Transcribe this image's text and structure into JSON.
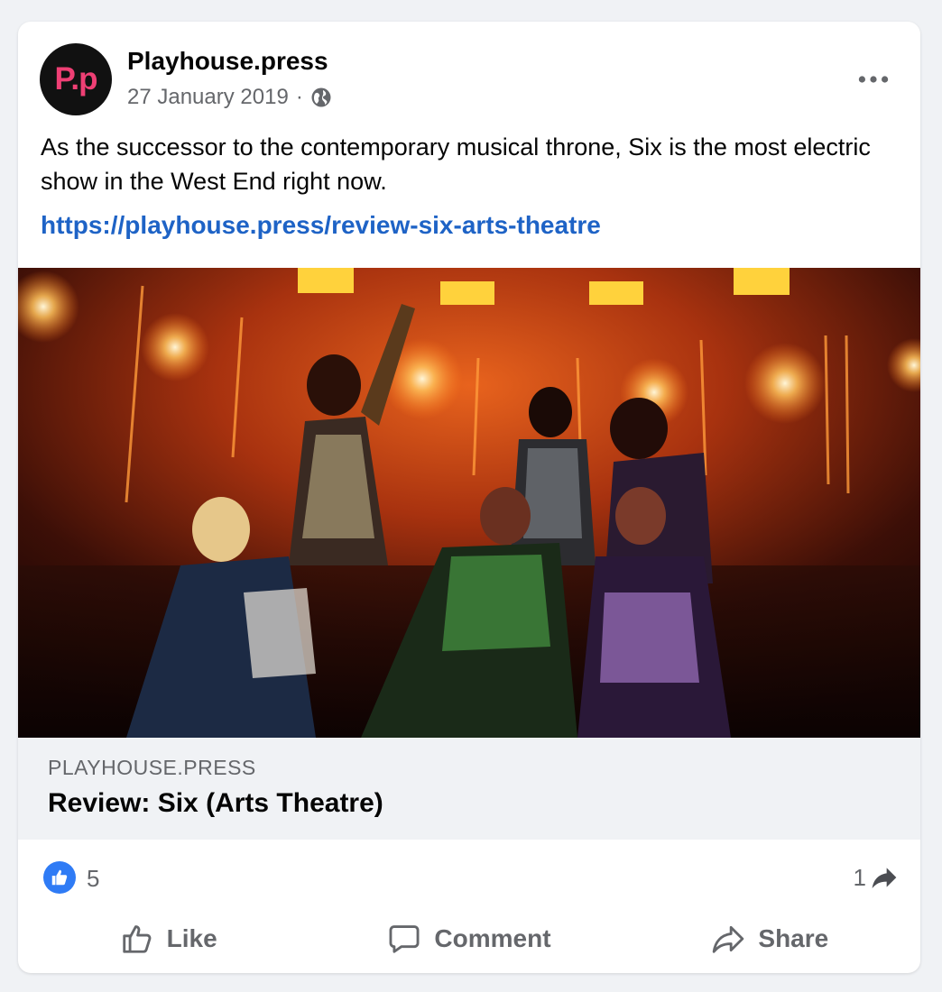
{
  "post": {
    "avatar_text": "P.p",
    "page_name": "Playhouse.press",
    "date": "27 January 2019",
    "separator": "·",
    "audience_icon": "globe-icon",
    "more_icon": "more-horizontal-icon",
    "text": "As the successor to the contemporary musical throne, Six is the most electric show in the West End right now.",
    "link": "https://playhouse.press/review-six-arts-theatre"
  },
  "preview": {
    "domain": "PLAYHOUSE.PRESS",
    "title": "Review: Six (Arts Theatre)",
    "image_description_icon": "stage-photo"
  },
  "stats": {
    "likes": "5",
    "shares": "1"
  },
  "actions": {
    "like": "Like",
    "comment": "Comment",
    "share": "Share"
  },
  "colors": {
    "brand_pink": "#ee3f74",
    "link_blue": "#1e63c6",
    "like_blue": "#2f7bf5",
    "muted": "#65676b",
    "preview_bg": "#f0f2f5"
  }
}
